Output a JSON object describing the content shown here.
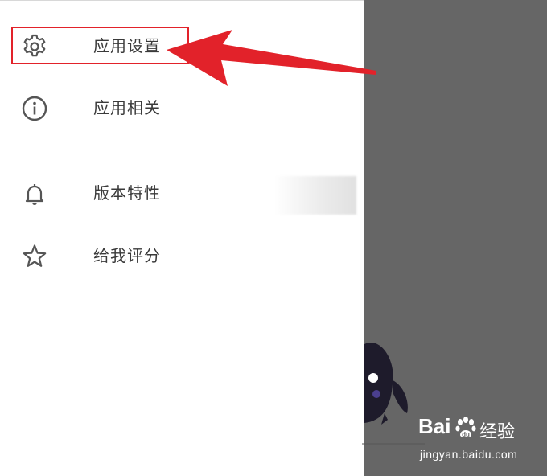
{
  "menu": {
    "items": [
      {
        "label": "应用设置",
        "icon": "gear-icon"
      },
      {
        "label": "应用相关",
        "icon": "info-icon"
      },
      {
        "label": "版本特性",
        "icon": "bell-icon"
      },
      {
        "label": "给我评分",
        "icon": "star-icon"
      }
    ]
  },
  "annotation": {
    "highlight_color": "#e2222a",
    "arrow_color": "#e2222a"
  },
  "overlay": {
    "color": "#666666"
  },
  "watermark": {
    "brand_prefix": "Bai",
    "brand_cn": "经验",
    "url": "jingyan.baidu.com"
  }
}
